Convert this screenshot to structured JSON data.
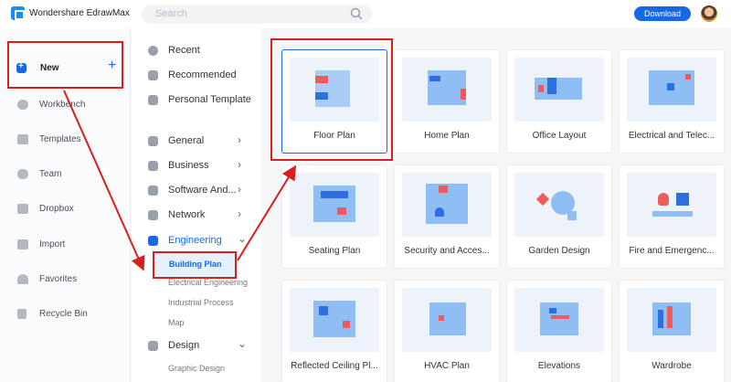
{
  "app": {
    "name": "Wondershare EdrawMax",
    "search_placeholder": "Search",
    "download_label": "Download"
  },
  "sidebar": {
    "items": [
      {
        "label": "New"
      },
      {
        "label": "Workbench"
      },
      {
        "label": "Templates"
      },
      {
        "label": "Team"
      },
      {
        "label": "Dropbox"
      },
      {
        "label": "Import"
      },
      {
        "label": "Favorites"
      },
      {
        "label": "Recycle Bin"
      }
    ]
  },
  "categories": {
    "top": [
      {
        "label": "Recent"
      },
      {
        "label": "Recommended"
      },
      {
        "label": "Personal Template"
      }
    ],
    "groups": [
      {
        "label": "General"
      },
      {
        "label": "Business"
      },
      {
        "label": "Software And..."
      },
      {
        "label": "Network"
      },
      {
        "label": "Engineering"
      },
      {
        "label": "Design"
      }
    ],
    "engineering_sub": [
      {
        "label": "Building Plan"
      },
      {
        "label": "Electrical Engineering"
      },
      {
        "label": "Industrial Process"
      },
      {
        "label": "Map"
      }
    ],
    "design_sub": [
      {
        "label": "Graphic Design"
      }
    ]
  },
  "templates": [
    {
      "label": "Floor Plan"
    },
    {
      "label": "Home Plan"
    },
    {
      "label": "Office Layout"
    },
    {
      "label": "Electrical and Telec..."
    },
    {
      "label": "Seating Plan"
    },
    {
      "label": "Security and Acces..."
    },
    {
      "label": "Garden Design"
    },
    {
      "label": "Fire and Emergenc..."
    },
    {
      "label": "Reflected Ceiling Pl..."
    },
    {
      "label": "HVAC Plan"
    },
    {
      "label": "Elevations"
    },
    {
      "label": "Wardrobe"
    }
  ],
  "colors": {
    "accent": "#1668e3",
    "highlight_box": "#d91e1e",
    "selected_card_border": "#1a6ae6"
  }
}
